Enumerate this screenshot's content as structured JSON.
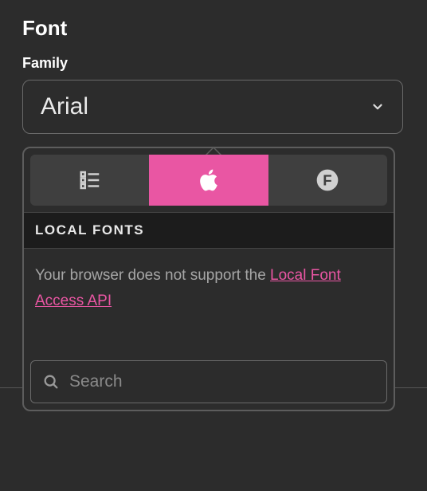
{
  "section": {
    "title": "Font"
  },
  "field": {
    "label": "Family",
    "value": "Arial"
  },
  "tabs": {
    "list_icon": "list-icon",
    "system_icon": "apple-icon",
    "f_icon": "circle-f-icon",
    "active_index": 1
  },
  "popover": {
    "header": "LOCAL FONTS",
    "message": "Your browser does not support the ",
    "link_text": "Local Font Access API"
  },
  "search": {
    "placeholder": "Search",
    "value": ""
  },
  "colors": {
    "accent": "#e956a3"
  }
}
